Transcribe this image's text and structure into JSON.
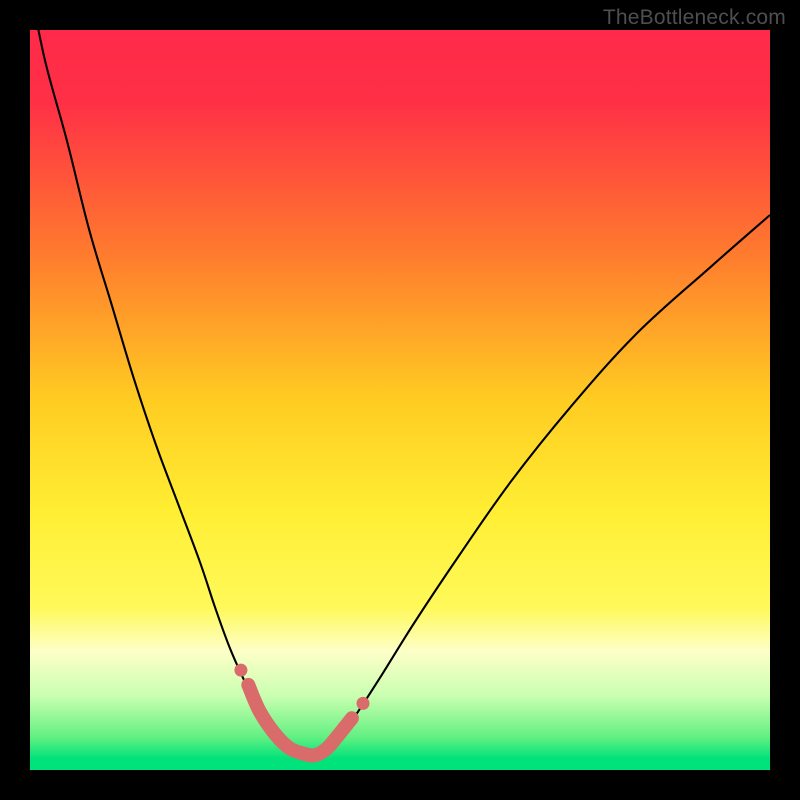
{
  "watermark": "TheBottleneck.com",
  "chart_data": {
    "type": "line",
    "title": "",
    "xlabel": "",
    "ylabel": "",
    "xlim": [
      0,
      100
    ],
    "ylim": [
      0,
      100
    ],
    "background_gradient": {
      "stops": [
        {
          "offset": 0.0,
          "color": "#ff2a4a"
        },
        {
          "offset": 0.1,
          "color": "#ff3046"
        },
        {
          "offset": 0.3,
          "color": "#ff7a2e"
        },
        {
          "offset": 0.5,
          "color": "#ffcc22"
        },
        {
          "offset": 0.65,
          "color": "#ffee33"
        },
        {
          "offset": 0.78,
          "color": "#fff95a"
        },
        {
          "offset": 0.84,
          "color": "#fdffc8"
        },
        {
          "offset": 0.9,
          "color": "#c9ffb0"
        },
        {
          "offset": 0.955,
          "color": "#63f082"
        },
        {
          "offset": 0.985,
          "color": "#00e27a"
        },
        {
          "offset": 1.0,
          "color": "#00e27a"
        }
      ]
    },
    "series": [
      {
        "name": "bottleneck-curve",
        "note": "values estimated from pixel positions; y is percent from top (0) to bottom (100)",
        "x": [
          0,
          2,
          5,
          8,
          11,
          14,
          17,
          20,
          23,
          25,
          27,
          29,
          31,
          33,
          35,
          37,
          38.5,
          40,
          43,
          47,
          52,
          58,
          65,
          73,
          82,
          92,
          100
        ],
        "y": [
          -6,
          4,
          15,
          27,
          37,
          47,
          56,
          64,
          72,
          78,
          83.5,
          88,
          92,
          95,
          97,
          97.8,
          98,
          97.2,
          94,
          88,
          80,
          71,
          61,
          51,
          41,
          32,
          25
        ]
      }
    ],
    "highlight": {
      "name": "optimal-range",
      "thick_segment_x": [
        29.5,
        31,
        33,
        35,
        37,
        38.5,
        40,
        41.5,
        43.5
      ],
      "thick_segment_y": [
        88.5,
        92,
        95,
        97,
        97.8,
        98,
        97.2,
        95.5,
        93
      ],
      "end_dots": [
        {
          "x": 28.5,
          "y": 86.5
        },
        {
          "x": 45,
          "y": 91
        }
      ]
    }
  }
}
